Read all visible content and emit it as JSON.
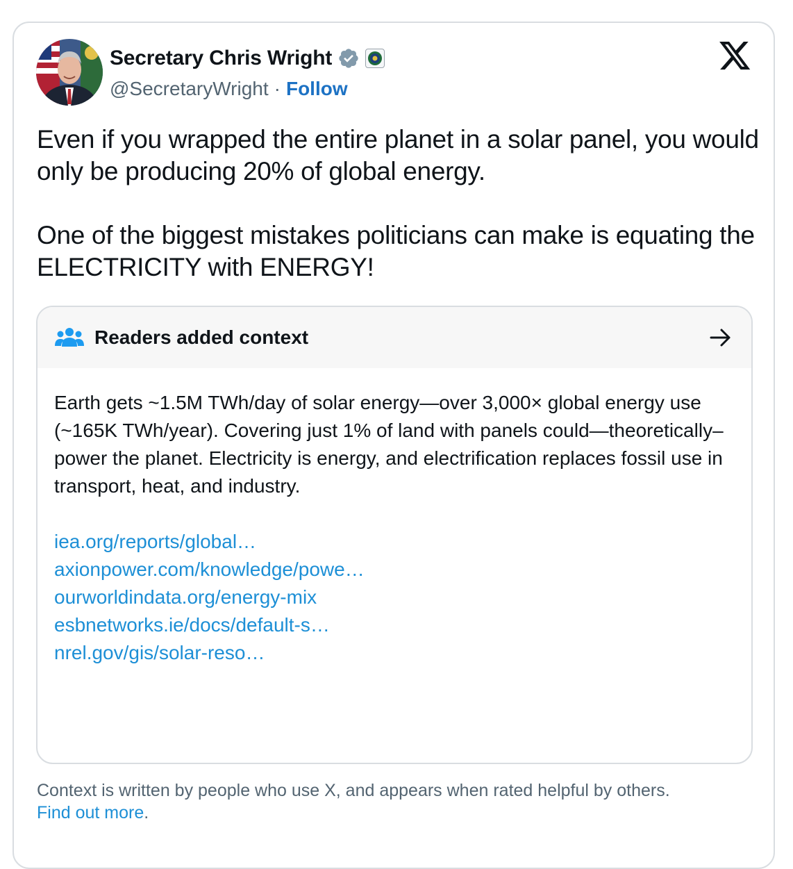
{
  "author": {
    "display_name": "Secretary Chris Wright",
    "handle": "@SecretaryWright",
    "separator": "·",
    "follow_label": "Follow"
  },
  "tweet": {
    "paragraphs": [
      "Even if you wrapped the entire planet in a solar panel, you would only be producing 20% of global energy.",
      "One of the biggest mistakes politicians can make is equating the ELECTRICITY with ENERGY!"
    ]
  },
  "community_note": {
    "title": "Readers added context",
    "body": "Earth gets ~1.5M TWh/day of solar energy—over 3,000× global energy use (~165K TWh/year). Covering just 1% of land with panels could—theoretically–power the planet. Electricity is energy, and electrification replaces fossil use in transport, heat, and industry.",
    "links": [
      "iea.org/reports/global…",
      "axionpower.com/knowledge/powe…",
      "ourworldindata.org/energy-mix",
      "esbnetworks.ie/docs/default-s…",
      "nrel.gov/gis/solar-reso…"
    ]
  },
  "footer": {
    "text": "Context is written by people who use X, and appears when rated helpful by others.",
    "link": "Find out more",
    "trailing": "."
  },
  "colors": {
    "verified_badge": "#829aab",
    "link_blue": "#1d8fd6",
    "follow_blue": "#1d72c4",
    "note_icon_blue": "#1d9bf0"
  },
  "icons": {
    "verified": "verified-badge-icon",
    "affiliation": "department-seal-icon",
    "platform": "x-logo-icon",
    "note": "people-icon",
    "open": "arrow-right-icon"
  }
}
